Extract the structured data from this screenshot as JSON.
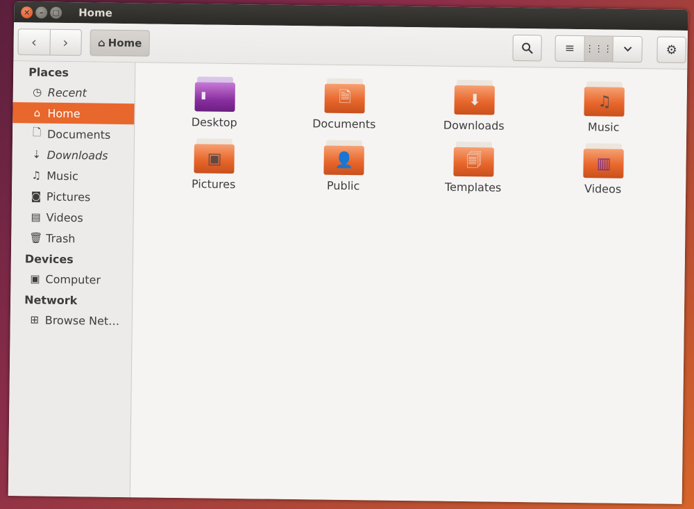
{
  "window": {
    "title": "Home"
  },
  "toolbar": {
    "path_label": "Home"
  },
  "sidebar": {
    "sections": [
      {
        "heading": "Places"
      },
      {
        "heading": "Devices"
      },
      {
        "heading": "Network"
      }
    ],
    "places": [
      {
        "label": "Recent",
        "icon": "clock-icon"
      },
      {
        "label": "Home",
        "icon": "home-icon"
      },
      {
        "label": "Documents",
        "icon": "document-icon"
      },
      {
        "label": "Downloads",
        "icon": "download-icon"
      },
      {
        "label": "Music",
        "icon": "music-icon"
      },
      {
        "label": "Pictures",
        "icon": "camera-icon"
      },
      {
        "label": "Videos",
        "icon": "film-icon"
      },
      {
        "label": "Trash",
        "icon": "trash-icon"
      }
    ],
    "devices": [
      {
        "label": "Computer",
        "icon": "computer-icon"
      }
    ],
    "network": [
      {
        "label": "Browse Net…",
        "icon": "network-icon"
      }
    ]
  },
  "files": [
    {
      "name": "Desktop",
      "emblem": "desktop-icon"
    },
    {
      "name": "Documents",
      "emblem": "document-icon"
    },
    {
      "name": "Downloads",
      "emblem": "download-icon"
    },
    {
      "name": "Music",
      "emblem": "music-icon"
    },
    {
      "name": "Pictures",
      "emblem": "picture-icon"
    },
    {
      "name": "Public",
      "emblem": "person-icon"
    },
    {
      "name": "Templates",
      "emblem": "template-icon"
    },
    {
      "name": "Videos",
      "emblem": "film-icon"
    }
  ],
  "colors": {
    "accent": "#e8672c",
    "titlebar": "#3c3b37",
    "desktop_folder": "#8a2fa0"
  }
}
